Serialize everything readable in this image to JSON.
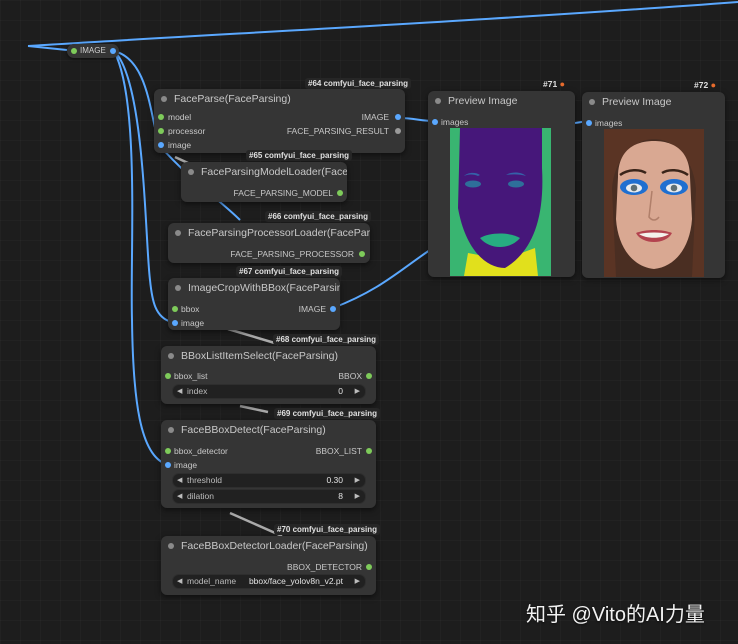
{
  "reroute": {
    "label": "IMAGE"
  },
  "nodes": {
    "face_parse": {
      "badge": "#64 comfyui_face_parsing",
      "title": "FaceParse(FaceParsing)",
      "inputs": [
        "model",
        "processor",
        "image"
      ],
      "outputs": [
        "IMAGE",
        "FACE_PARSING_RESULT"
      ]
    },
    "model_loader": {
      "badge": "#65 comfyui_face_parsing",
      "title": "FaceParsingModelLoader(FaceParsing)",
      "outputs": [
        "FACE_PARSING_MODEL"
      ]
    },
    "processor_loader": {
      "badge": "#66 comfyui_face_parsing",
      "title": "FaceParsingProcessorLoader(FaceParsing)",
      "outputs": [
        "FACE_PARSING_PROCESSOR"
      ]
    },
    "crop": {
      "badge": "#67 comfyui_face_parsing",
      "title": "ImageCropWithBBox(FaceParsing)",
      "inputs": [
        "bbox",
        "image"
      ],
      "outputs": [
        "IMAGE"
      ]
    },
    "bbox_select": {
      "badge": "#68 comfyui_face_parsing",
      "title": "BBoxListItemSelect(FaceParsing)",
      "inputs": [
        "bbox_list"
      ],
      "outputs": [
        "BBOX"
      ],
      "widgets": [
        {
          "name": "index",
          "value": "0"
        }
      ]
    },
    "bbox_detect": {
      "badge": "#69 comfyui_face_parsing",
      "title": "FaceBBoxDetect(FaceParsing)",
      "inputs": [
        "bbox_detector",
        "image"
      ],
      "outputs": [
        "BBOX_LIST"
      ],
      "widgets": [
        {
          "name": "threshold",
          "value": "0.30"
        },
        {
          "name": "dilation",
          "value": "8"
        }
      ]
    },
    "detector_loader": {
      "badge": "#70 comfyui_face_parsing",
      "title": "FaceBBoxDetectorLoader(FaceParsing)",
      "outputs": [
        "BBOX_DETECTOR"
      ],
      "widgets": [
        {
          "name": "model_name",
          "value": "bbox/face_yolov8n_v2.pt"
        }
      ]
    },
    "preview1": {
      "badge": "#71",
      "title": "Preview Image",
      "inputs": [
        "images"
      ]
    },
    "preview2": {
      "badge": "#72",
      "title": "Preview Image",
      "inputs": [
        "images"
      ]
    }
  },
  "watermark": "知乎 @Vito的AI力量",
  "colors": {
    "background": "#1d1d1d",
    "node": "#353535",
    "wire_image": "#5aa8ff",
    "socket_model": "#7ecb5a",
    "badge_icon": "#e86b2c"
  },
  "icons": {
    "badge_icon": "fox-icon"
  }
}
